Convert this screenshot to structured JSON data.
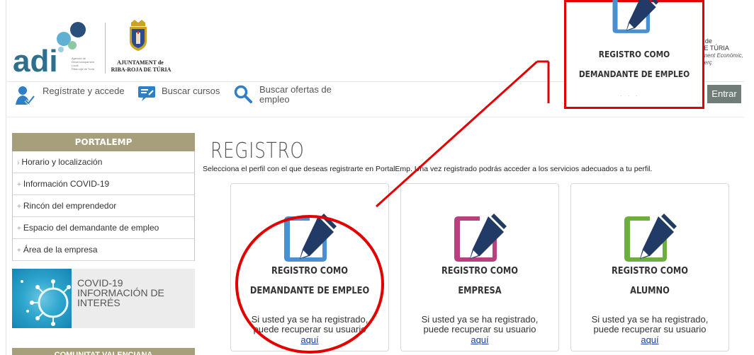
{
  "header": {
    "adi_logo_text": "adi",
    "adi_subtitle_lines": [
      "Agència de",
      "Desenvolupament",
      "Local",
      "Riba-roja de Túria"
    ],
    "ayto_line1": "AJUNTAMENT de",
    "ayto_line2": "RIBA-ROJA DE TÚRIA",
    "right_lines": [
      "T de",
      "DE TÚRIA",
      "oment Econòmic,",
      "merç"
    ]
  },
  "nav": {
    "register": "Regístrate y accede",
    "courses": "Buscar cursos",
    "offers": "Buscar ofertas de empleo",
    "login_button": "Entrar"
  },
  "sidebar": {
    "header": "PORTALEMP",
    "items": [
      {
        "bullet": "›",
        "label": "Horario y localización"
      },
      {
        "bullet": "+",
        "label": "Información COVID-19"
      },
      {
        "bullet": "+",
        "label": "Rincón del emprendedor"
      },
      {
        "bullet": "+",
        "label": "Espacio del demandante de empleo"
      },
      {
        "bullet": "+",
        "label": "Área de la empresa"
      }
    ],
    "covid_lines": [
      "COVID-19",
      "INFORMACIÓN DE",
      "INTERÉS"
    ],
    "comunitat": "COMUNITAT VALENCIANA"
  },
  "main": {
    "title": "REGISTRO",
    "intro": "Selecciona el perfil con el que deseas registrarte en PortalEmp. Una vez registrado podrás acceder a los servicios adecuados a tu perfil.",
    "cards": [
      {
        "title1": "REGISTRO COMO",
        "title2": "DEMANDANTE DE EMPLEO",
        "note1": "Si usted ya se ha registrado,",
        "note2": "puede recuperar su usuario",
        "link": "aquí",
        "color": "#4a8fd0"
      },
      {
        "title1": "REGISTRO COMO",
        "title2": "EMPRESA",
        "note1": "Si usted ya se ha registrado,",
        "note2": "puede recuperar su usuario",
        "link": "aquí",
        "color": "#b8407f"
      },
      {
        "title1": "REGISTRO COMO",
        "title2": "ALUMNO",
        "note1": "Si usted ya se ha registrado,",
        "note2": "puede recuperar su usuario",
        "link": "aquí",
        "color": "#6cae3f"
      }
    ]
  },
  "zoom": {
    "title1": "REGISTRO COMO",
    "title2": "DEMANDANTE DE EMPLEO"
  },
  "colors": {
    "accent_red": "#e30000",
    "sidebar_header": "#a79f7c",
    "login_button": "#707c78",
    "link": "#1a3fa8",
    "nav_icon_blue": "#2f7fc6"
  },
  "icons": [
    "user-register-icon",
    "courses-icon",
    "search-icon",
    "document-pen-icon",
    "covid-virus-icon",
    "shield-icon"
  ]
}
